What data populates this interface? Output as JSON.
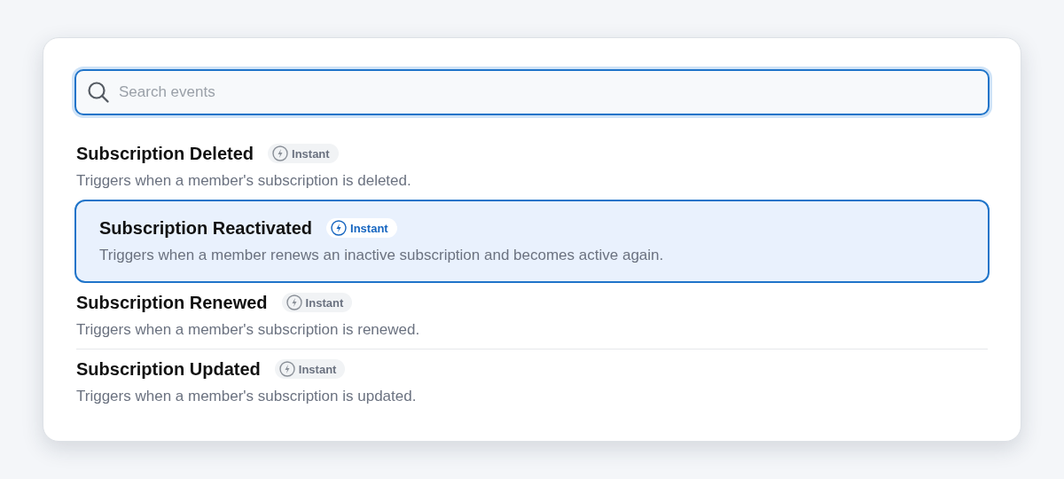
{
  "search": {
    "placeholder": "Search events"
  },
  "events": [
    {
      "title": "Subscription Deleted",
      "badge": "Instant",
      "description": "Triggers when a member's subscription is deleted.",
      "selected": false
    },
    {
      "title": "Subscription Reactivated",
      "badge": "Instant",
      "description": "Triggers when a member renews an inactive subscription and becomes active again.",
      "selected": true
    },
    {
      "title": "Subscription Renewed",
      "badge": "Instant",
      "description": "Triggers when a member's subscription is renewed.",
      "selected": false
    },
    {
      "title": "Subscription Updated",
      "badge": "Instant",
      "description": "Triggers when a member's subscription is updated.",
      "selected": false
    }
  ]
}
